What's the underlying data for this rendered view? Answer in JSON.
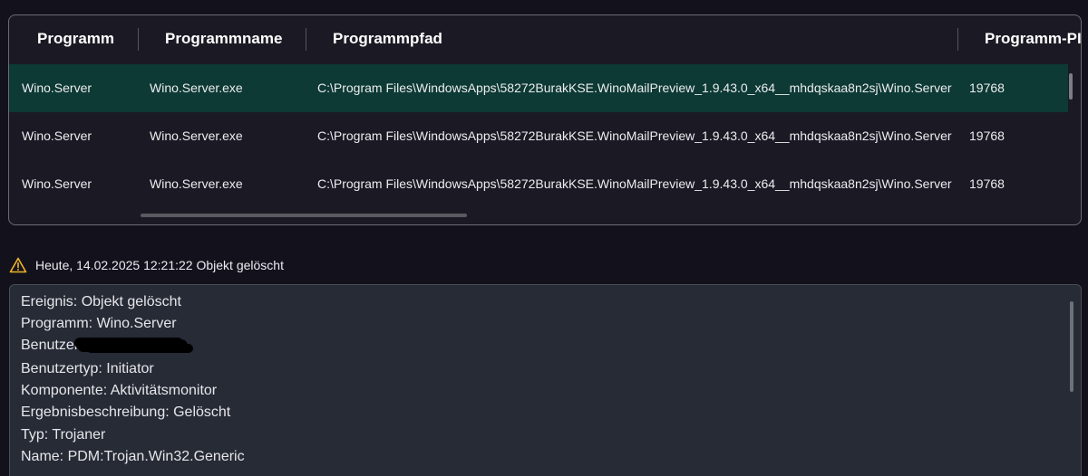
{
  "table": {
    "columns": [
      "Programm",
      "Programmname",
      "Programmpfad",
      "Programm-PII"
    ],
    "rows": [
      {
        "programm": "Wino.Server",
        "name": "Wino.Server.exe",
        "pfad": "C:\\Program Files\\WindowsApps\\58272BurakKSE.WinoMailPreview_1.9.43.0_x64__mhdqskaa8n2sj\\Wino.Server",
        "pid": "19768"
      },
      {
        "programm": "Wino.Server",
        "name": "Wino.Server.exe",
        "pfad": "C:\\Program Files\\WindowsApps\\58272BurakKSE.WinoMailPreview_1.9.43.0_x64__mhdqskaa8n2sj\\Wino.Server",
        "pid": "19768"
      },
      {
        "programm": "Wino.Server",
        "name": "Wino.Server.exe",
        "pfad": "C:\\Program Files\\WindowsApps\\58272BurakKSE.WinoMailPreview_1.9.43.0_x64__mhdqskaa8n2sj\\Wino.Server",
        "pid": "19768"
      }
    ]
  },
  "event": {
    "icon": "warning-icon",
    "text": "Heute, 14.02.2025 12:21:22 Objekt gelöscht"
  },
  "details": {
    "ereignis": "Ereignis: Objekt gelöscht",
    "programm": "Programm: Wino.Server",
    "benutzer": "Benutzer:",
    "benutzertyp": "Benutzertyp: Initiator",
    "komponente": "Komponente: Aktivitätsmonitor",
    "ergebnis": "Ergebnisbeschreibung: Gelöscht",
    "typ": "Typ: Trojaner",
    "name": "Name: PDM:Trojan.Win32.Generic"
  },
  "colors": {
    "background": "#13121c",
    "selected_row": "#0d3a34",
    "warning": "#f0b429"
  }
}
